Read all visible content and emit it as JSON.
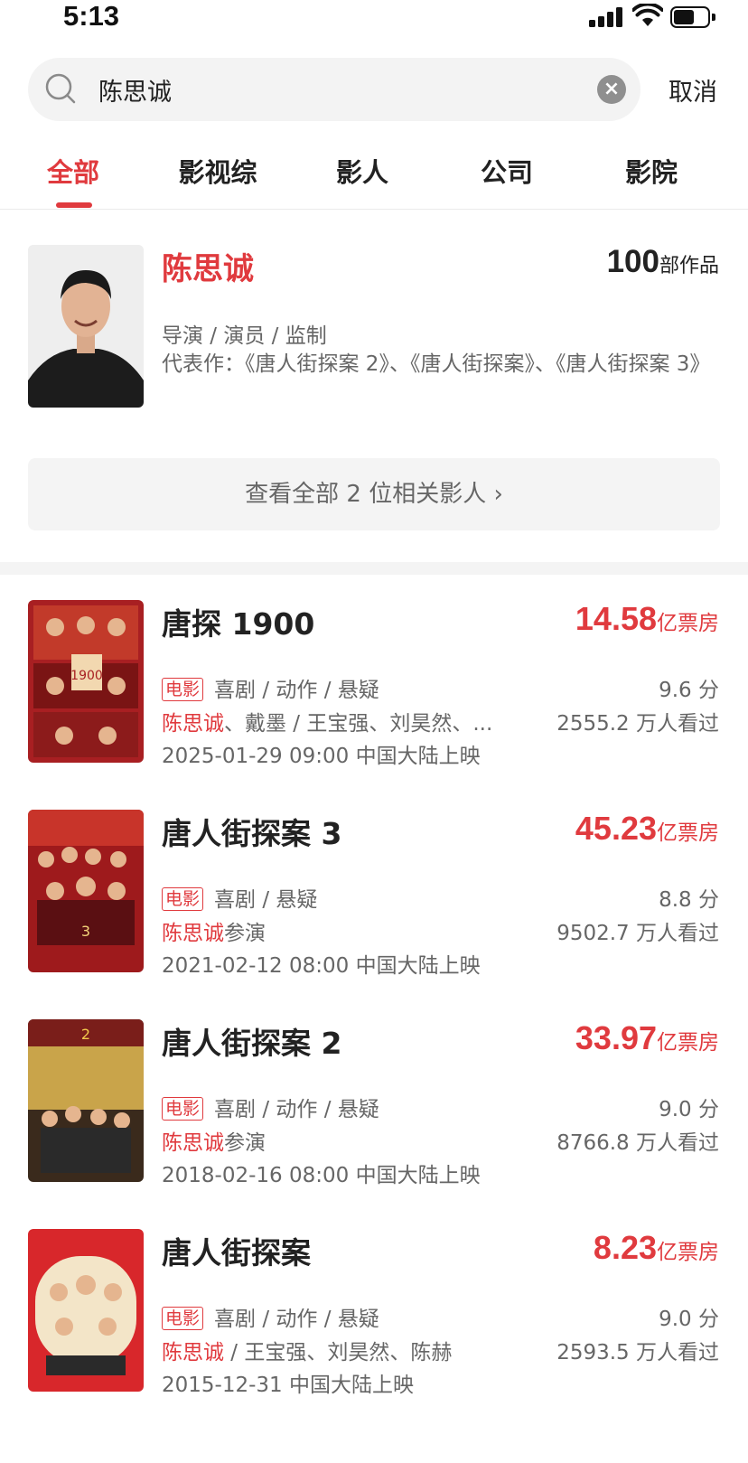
{
  "status_bar": {
    "time": "5:13"
  },
  "search": {
    "query": "陈思诚",
    "cancel_label": "取消"
  },
  "tabs": [
    {
      "label": "全部"
    },
    {
      "label": "影视综"
    },
    {
      "label": "影人"
    },
    {
      "label": "公司"
    },
    {
      "label": "影院"
    }
  ],
  "person": {
    "name": "陈思诚",
    "works_count": "100",
    "works_suffix": "部作品",
    "roles": "导演 / 演员 / 监制",
    "representative": "代表作：《唐人街探案 2》、《唐人街探案》、《唐人街探案 3》"
  },
  "all_people_button": "查看全部 2 位相关影人 ›",
  "colors": {
    "accent": "#e03a3e",
    "text": "#222222",
    "muted": "#666666",
    "bg_light": "#f4f4f4"
  },
  "movies": [
    {
      "title": "唐探 1900",
      "box_office": "14.58",
      "box_unit": "亿票房",
      "tag": "电影",
      "genre": "喜剧 / 动作 / 悬疑",
      "score": "9.6 分",
      "cast_highlight": "陈思诚",
      "cast_rest": "、戴墨 / 王宝强、刘昊然、...",
      "views": "2555.2 万人看过",
      "release": "2025-01-29 09:00 中国大陆上映"
    },
    {
      "title": "唐人街探案 3",
      "box_office": "45.23",
      "box_unit": "亿票房",
      "tag": "电影",
      "genre": "喜剧 / 悬疑",
      "score": "8.8 分",
      "cast_highlight": "陈思诚",
      "cast_rest": "参演",
      "views": "9502.7 万人看过",
      "release": "2021-02-12 08:00 中国大陆上映"
    },
    {
      "title": "唐人街探案 2",
      "box_office": "33.97",
      "box_unit": "亿票房",
      "tag": "电影",
      "genre": "喜剧 / 动作 / 悬疑",
      "score": "9.0 分",
      "cast_highlight": "陈思诚",
      "cast_rest": "参演",
      "views": "8766.8 万人看过",
      "release": "2018-02-16 08:00 中国大陆上映"
    },
    {
      "title": "唐人街探案",
      "box_office": "8.23",
      "box_unit": "亿票房",
      "tag": "电影",
      "genre": "喜剧 / 动作 / 悬疑",
      "score": "9.0 分",
      "cast_highlight": "陈思诚",
      "cast_rest": " / 王宝强、刘昊然、陈赫",
      "views": "2593.5 万人看过",
      "release": "2015-12-31 中国大陆上映"
    }
  ]
}
